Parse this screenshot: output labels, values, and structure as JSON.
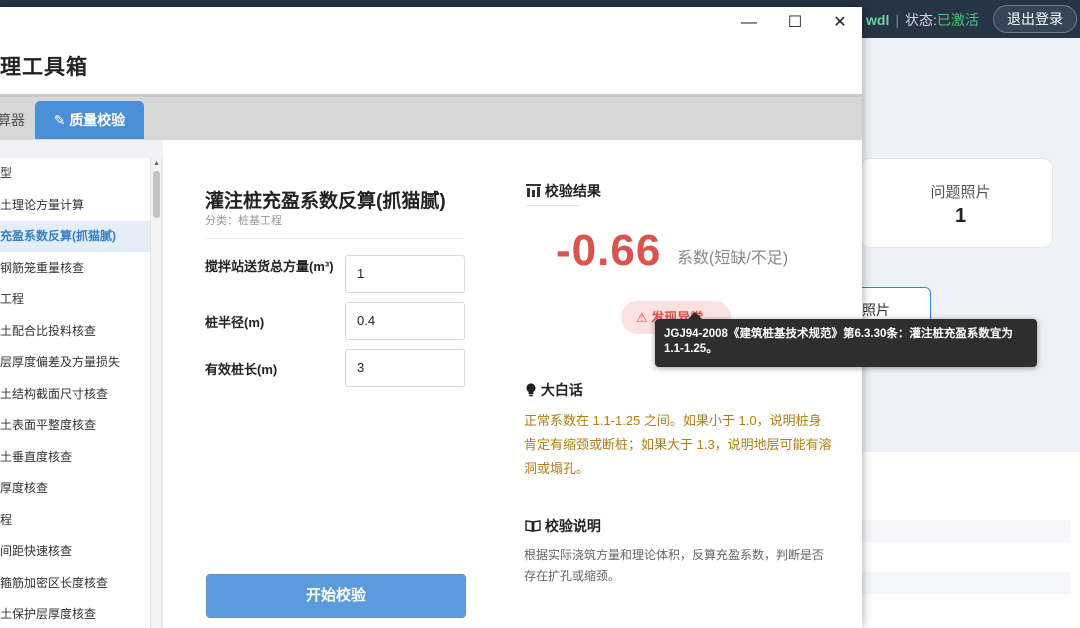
{
  "background": {
    "username": "wdl",
    "separator": "|",
    "status_label": "状态:",
    "status_value": "已激活",
    "logout_label": "退出登录",
    "photo_card_label": "问题照片",
    "photo_card_count": "1",
    "photo_button_label": "照片"
  },
  "window": {
    "minimize_glyph": "—",
    "maximize_glyph": "☐",
    "close_glyph": "✕",
    "title": "理工具箱"
  },
  "tabs": [
    {
      "label": "算器"
    },
    {
      "label": "质量校验",
      "icon": "pencil-icon",
      "icon_glyph": "✎"
    }
  ],
  "sidebar": {
    "items": [
      {
        "label": "型",
        "active": false
      },
      {
        "label": "土理论方量计算",
        "active": false
      },
      {
        "label": "充盈系数反算(抓猫腻)",
        "active": true
      },
      {
        "label": "钢筋笼重量核查",
        "active": false
      },
      {
        "label": "工程",
        "active": false
      },
      {
        "label": "土配合比投料核查",
        "active": false
      },
      {
        "label": "层厚度偏差及方量损失",
        "active": false
      },
      {
        "label": "土结构截面尺寸核查",
        "active": false
      },
      {
        "label": "土表面平整度核查",
        "active": false
      },
      {
        "label": "土垂直度核查",
        "active": false
      },
      {
        "label": "厚度核查",
        "active": false
      },
      {
        "label": "程",
        "active": false
      },
      {
        "label": "间距快速核查",
        "active": false
      },
      {
        "label": "箍筋加密区长度核查",
        "active": false
      },
      {
        "label": "土保护层厚度核查",
        "active": false
      }
    ]
  },
  "calculator": {
    "title": "灌注桩充盈系数反算(抓猫腻)",
    "category": "分类：桩基工程",
    "fields": [
      {
        "label": "搅拌站送货总方量(m³)",
        "value": "1"
      },
      {
        "label": "桩半径(m)",
        "value": "0.4"
      },
      {
        "label": "有效桩长(m)",
        "value": "3"
      }
    ],
    "start_button": "开始校验"
  },
  "result": {
    "header_icon": "chart-icon",
    "header": "校验结果",
    "value": "-0.66",
    "unit_text": "系数(短缺/不足)",
    "badge": "⚠ 发现异常",
    "tooltip": "JGJ94-2008《建筑桩基技术规范》第6.3.30条：灌注桩充盈系数宜为1.1-1.25。",
    "plain_talk_icon": "bulb-icon",
    "plain_talk_title": "大白话",
    "plain_talk_text": "正常系数在 1.1-1.25 之间。如果小于 1.0，说明桩身肯定有缩颈或断桩；如果大于 1.3，说明地层可能有溶洞或塌孔。",
    "note_icon": "book-icon",
    "note_title": "校验说明",
    "note_text": "根据实际浇筑方量和理论体积，反算充盈系数，判断是否存在扩孔或缩颈。"
  },
  "colors": {
    "accent": "#4a90d9",
    "danger": "#d9534f",
    "warning_text": "#b07d14",
    "status_ok": "#48c774"
  }
}
